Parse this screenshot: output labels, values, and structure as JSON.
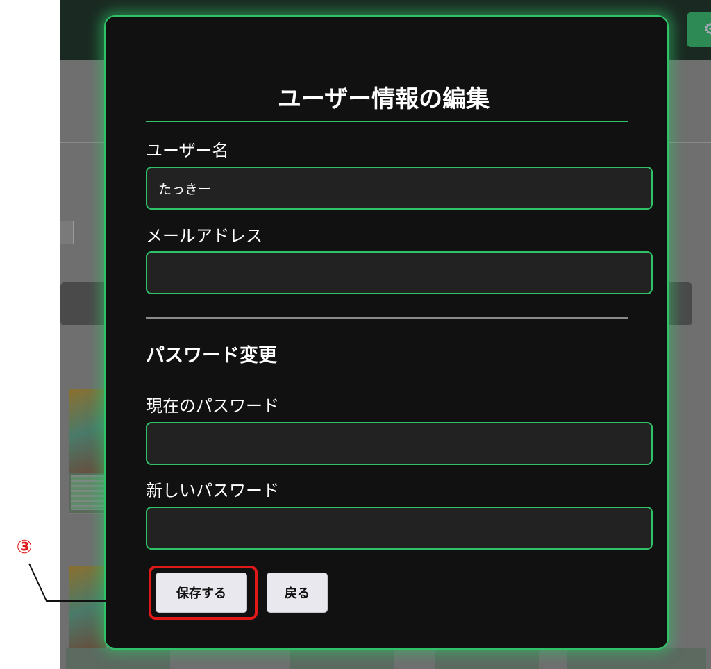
{
  "modal": {
    "title": "ユーザー情報の編集",
    "username": {
      "label": "ユーザー名",
      "value": "たっきー"
    },
    "email": {
      "label": "メールアドレス",
      "value": ""
    },
    "password_section": {
      "heading": "パスワード変更",
      "current": {
        "label": "現在のパスワード",
        "value": ""
      },
      "new": {
        "label": "新しいパスワード",
        "value": ""
      }
    },
    "buttons": {
      "save_label": "保存する",
      "back_label": "戻る"
    }
  },
  "annotation": {
    "step_marker": "③"
  },
  "colors": {
    "accent": "#2fc268",
    "modal_bg": "#111111",
    "input_bg": "#222222",
    "highlight": "#e01818"
  }
}
